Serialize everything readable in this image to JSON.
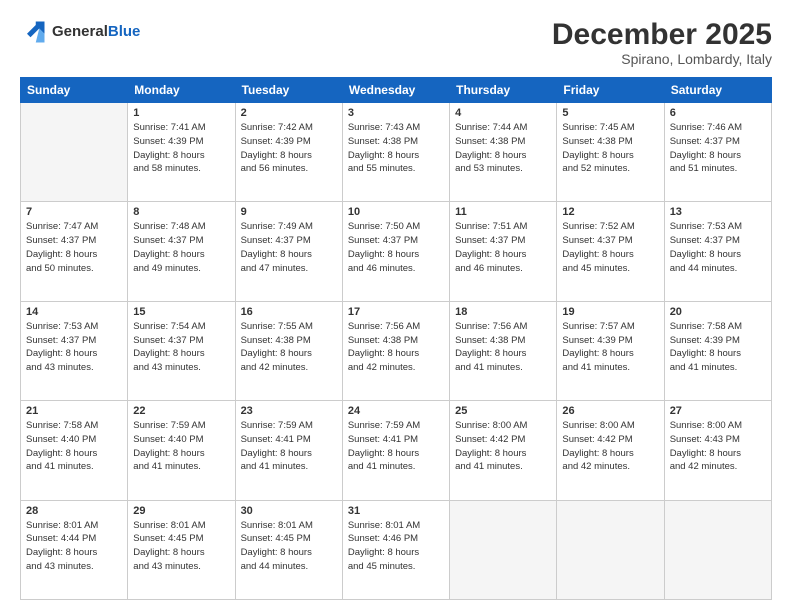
{
  "header": {
    "logo_line1": "General",
    "logo_line2": "Blue",
    "month": "December 2025",
    "location": "Spirano, Lombardy, Italy"
  },
  "weekdays": [
    "Sunday",
    "Monday",
    "Tuesday",
    "Wednesday",
    "Thursday",
    "Friday",
    "Saturday"
  ],
  "weeks": [
    [
      {
        "day": "",
        "info": ""
      },
      {
        "day": "1",
        "info": "Sunrise: 7:41 AM\nSunset: 4:39 PM\nDaylight: 8 hours\nand 58 minutes."
      },
      {
        "day": "2",
        "info": "Sunrise: 7:42 AM\nSunset: 4:39 PM\nDaylight: 8 hours\nand 56 minutes."
      },
      {
        "day": "3",
        "info": "Sunrise: 7:43 AM\nSunset: 4:38 PM\nDaylight: 8 hours\nand 55 minutes."
      },
      {
        "day": "4",
        "info": "Sunrise: 7:44 AM\nSunset: 4:38 PM\nDaylight: 8 hours\nand 53 minutes."
      },
      {
        "day": "5",
        "info": "Sunrise: 7:45 AM\nSunset: 4:38 PM\nDaylight: 8 hours\nand 52 minutes."
      },
      {
        "day": "6",
        "info": "Sunrise: 7:46 AM\nSunset: 4:37 PM\nDaylight: 8 hours\nand 51 minutes."
      }
    ],
    [
      {
        "day": "7",
        "info": "Sunrise: 7:47 AM\nSunset: 4:37 PM\nDaylight: 8 hours\nand 50 minutes."
      },
      {
        "day": "8",
        "info": "Sunrise: 7:48 AM\nSunset: 4:37 PM\nDaylight: 8 hours\nand 49 minutes."
      },
      {
        "day": "9",
        "info": "Sunrise: 7:49 AM\nSunset: 4:37 PM\nDaylight: 8 hours\nand 47 minutes."
      },
      {
        "day": "10",
        "info": "Sunrise: 7:50 AM\nSunset: 4:37 PM\nDaylight: 8 hours\nand 46 minutes."
      },
      {
        "day": "11",
        "info": "Sunrise: 7:51 AM\nSunset: 4:37 PM\nDaylight: 8 hours\nand 46 minutes."
      },
      {
        "day": "12",
        "info": "Sunrise: 7:52 AM\nSunset: 4:37 PM\nDaylight: 8 hours\nand 45 minutes."
      },
      {
        "day": "13",
        "info": "Sunrise: 7:53 AM\nSunset: 4:37 PM\nDaylight: 8 hours\nand 44 minutes."
      }
    ],
    [
      {
        "day": "14",
        "info": "Sunrise: 7:53 AM\nSunset: 4:37 PM\nDaylight: 8 hours\nand 43 minutes."
      },
      {
        "day": "15",
        "info": "Sunrise: 7:54 AM\nSunset: 4:37 PM\nDaylight: 8 hours\nand 43 minutes."
      },
      {
        "day": "16",
        "info": "Sunrise: 7:55 AM\nSunset: 4:38 PM\nDaylight: 8 hours\nand 42 minutes."
      },
      {
        "day": "17",
        "info": "Sunrise: 7:56 AM\nSunset: 4:38 PM\nDaylight: 8 hours\nand 42 minutes."
      },
      {
        "day": "18",
        "info": "Sunrise: 7:56 AM\nSunset: 4:38 PM\nDaylight: 8 hours\nand 41 minutes."
      },
      {
        "day": "19",
        "info": "Sunrise: 7:57 AM\nSunset: 4:39 PM\nDaylight: 8 hours\nand 41 minutes."
      },
      {
        "day": "20",
        "info": "Sunrise: 7:58 AM\nSunset: 4:39 PM\nDaylight: 8 hours\nand 41 minutes."
      }
    ],
    [
      {
        "day": "21",
        "info": "Sunrise: 7:58 AM\nSunset: 4:40 PM\nDaylight: 8 hours\nand 41 minutes."
      },
      {
        "day": "22",
        "info": "Sunrise: 7:59 AM\nSunset: 4:40 PM\nDaylight: 8 hours\nand 41 minutes."
      },
      {
        "day": "23",
        "info": "Sunrise: 7:59 AM\nSunset: 4:41 PM\nDaylight: 8 hours\nand 41 minutes."
      },
      {
        "day": "24",
        "info": "Sunrise: 7:59 AM\nSunset: 4:41 PM\nDaylight: 8 hours\nand 41 minutes."
      },
      {
        "day": "25",
        "info": "Sunrise: 8:00 AM\nSunset: 4:42 PM\nDaylight: 8 hours\nand 41 minutes."
      },
      {
        "day": "26",
        "info": "Sunrise: 8:00 AM\nSunset: 4:42 PM\nDaylight: 8 hours\nand 42 minutes."
      },
      {
        "day": "27",
        "info": "Sunrise: 8:00 AM\nSunset: 4:43 PM\nDaylight: 8 hours\nand 42 minutes."
      }
    ],
    [
      {
        "day": "28",
        "info": "Sunrise: 8:01 AM\nSunset: 4:44 PM\nDaylight: 8 hours\nand 43 minutes."
      },
      {
        "day": "29",
        "info": "Sunrise: 8:01 AM\nSunset: 4:45 PM\nDaylight: 8 hours\nand 43 minutes."
      },
      {
        "day": "30",
        "info": "Sunrise: 8:01 AM\nSunset: 4:45 PM\nDaylight: 8 hours\nand 44 minutes."
      },
      {
        "day": "31",
        "info": "Sunrise: 8:01 AM\nSunset: 4:46 PM\nDaylight: 8 hours\nand 45 minutes."
      },
      {
        "day": "",
        "info": ""
      },
      {
        "day": "",
        "info": ""
      },
      {
        "day": "",
        "info": ""
      }
    ]
  ]
}
